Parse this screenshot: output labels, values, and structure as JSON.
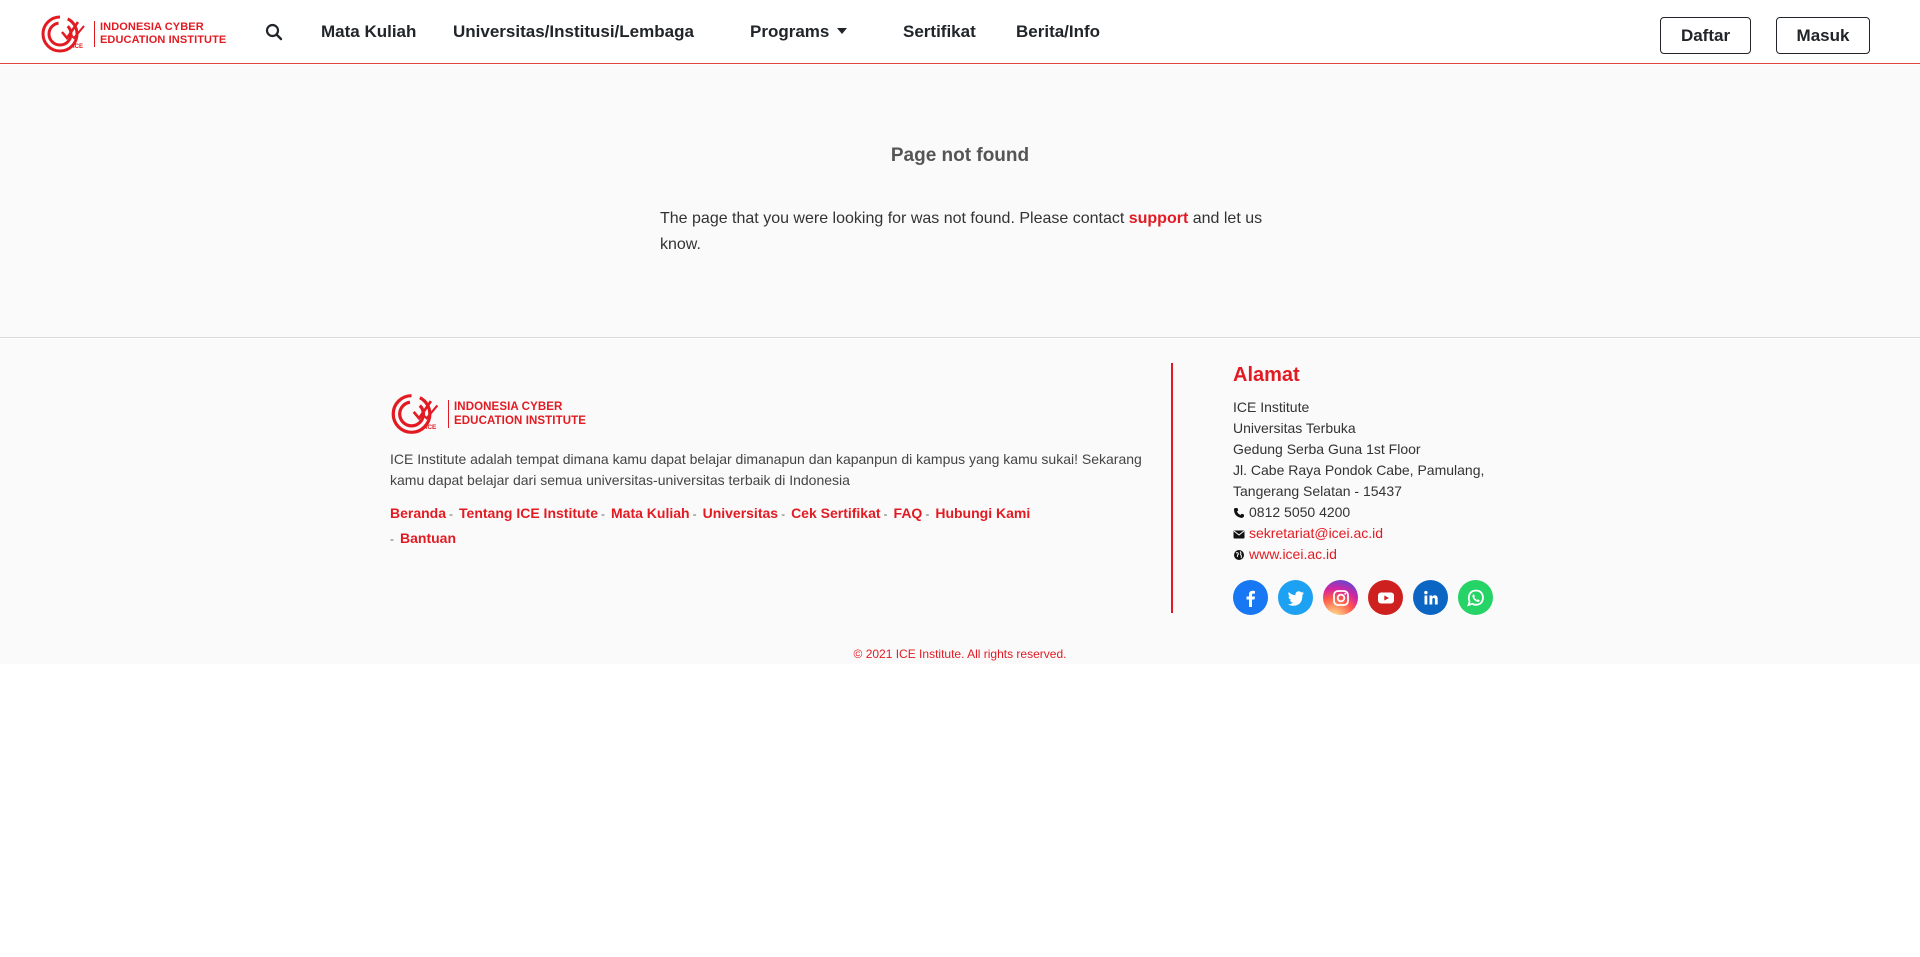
{
  "brand": {
    "line1": "INDONESIA CYBER",
    "line2": "EDUCATION INSTITUTE",
    "color": "#e21b23"
  },
  "nav": {
    "search_icon": "search-icon",
    "links": [
      "Mata Kuliah",
      "Universitas/Institusi/Lembaga",
      "Programs",
      "Sertifikat",
      "Berita/Info"
    ],
    "register_label": "Daftar",
    "login_label": "Masuk"
  },
  "main": {
    "title": "Page not found",
    "message_before": "The page that you were looking for was not found. Please contact ",
    "support_link": "support",
    "message_after": " and let us know."
  },
  "footer": {
    "description": "ICE Institute adalah tempat dimana kamu dapat belajar dimanapun dan kapanpun di kampus yang kamu sukai! Sekarang kamu dapat belajar dari semua universitas-universitas terbaik di Indonesia",
    "links": [
      "Beranda",
      "Tentang ICE Institute",
      "Mata Kuliah",
      "Universitas",
      "Cek Sertifikat",
      "FAQ",
      "Hubungi Kami",
      "Bantuan"
    ],
    "separator": "-",
    "address_title": "Alamat",
    "address_lines": [
      "ICE Institute",
      "Universitas Terbuka",
      "Gedung Serba Guna 1st Floor",
      "Jl. Cabe Raya Pondok Cabe, Pamulang,",
      "Tangerang Selatan - 15437"
    ],
    "phone": "0812 5050 4200",
    "email": "sekretariat@icei.ac.id",
    "website": "www.icei.ac.id",
    "socials": [
      "facebook-icon",
      "twitter-icon",
      "instagram-icon",
      "youtube-icon",
      "linkedin-icon",
      "whatsapp-icon"
    ],
    "copyright": "© 2021 ICE Institute. All rights reserved."
  }
}
